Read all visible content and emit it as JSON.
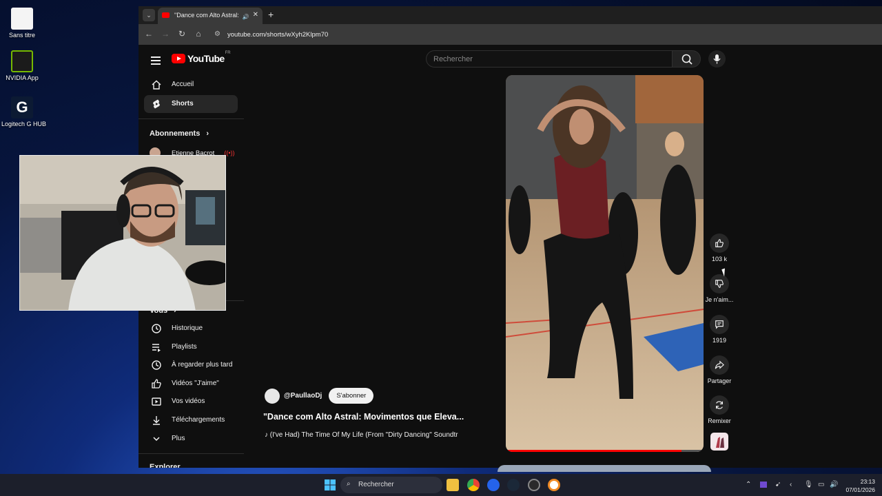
{
  "desktop": {
    "icons": [
      {
        "label": "Sans titre"
      },
      {
        "label": "NVIDIA App"
      },
      {
        "label": "Logitech G HUB"
      }
    ]
  },
  "browser": {
    "tab_title": "\"Dance com Alto Astral: Mo",
    "url": "youtube.com/shorts/wXyh2Klpm70"
  },
  "youtube": {
    "region": "FR",
    "search_placeholder": "Rechercher",
    "sidebar": {
      "main_items": [
        {
          "label": "Accueil",
          "icon": "home-icon"
        },
        {
          "label": "Shorts",
          "icon": "shorts-icon",
          "active": true
        }
      ],
      "subscriptions_heading": "Abonnements",
      "subscription": "Etienne Bacrot",
      "you_heading": "Vous",
      "you_items": [
        {
          "label": "Historique",
          "icon": "history-icon"
        },
        {
          "label": "Playlists",
          "icon": "playlist-icon"
        },
        {
          "label": "À regarder plus tard",
          "icon": "clock-icon"
        },
        {
          "label": "Vidéos \"J'aime\"",
          "icon": "like-icon"
        },
        {
          "label": "Vos vidéos",
          "icon": "video-icon"
        },
        {
          "label": "Téléchargements",
          "icon": "download-icon"
        },
        {
          "label": "Plus",
          "icon": "chevron-down-icon"
        }
      ],
      "explore_heading": "Explorer"
    },
    "short": {
      "channel": "@PaullaoDj",
      "subscribe_label": "S'abonner",
      "title": "\"Dance com Alto Astral: Movimentos que Eleva...",
      "music": "(I've Had) The Time Of My Life (From \"Dirty Dancing\" Soundtr",
      "progress_fraction": 0.89,
      "actions": {
        "likes": "103 k",
        "dislike_label": "Je n'aim...",
        "comments": "1919",
        "share_label": "Partager",
        "remix_label": "Remixer"
      }
    }
  },
  "taskbar": {
    "search_placeholder": "Rechercher",
    "time": "23:13",
    "date": "07/01/2026"
  }
}
